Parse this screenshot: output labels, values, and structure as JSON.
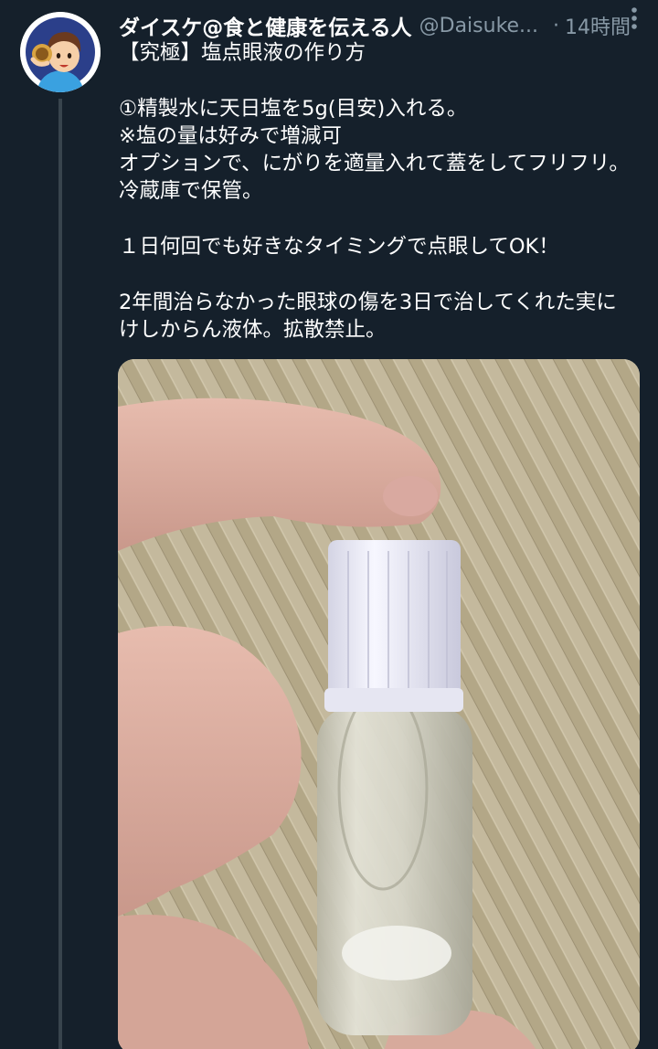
{
  "tweet": {
    "display_name": "ダイスケ@食と健康を伝える人",
    "handle": "@Daisuke...",
    "separator": "·",
    "timestamp": "14時間",
    "lines": [
      "【究極】塩点眼液の作り方",
      "",
      "①精製水に天日塩を5g(目安)入れる。",
      "※塩の量は好みで増減可",
      "オプションで、にがりを適量入れて蓋をしてフリフリ。",
      "冷蔵庫で保管。",
      "",
      "１日何回でも好きなタイミングで点眼してOK！",
      "",
      "2年間治らなかった眼球の傷を3日で治してくれた実に",
      "けしからん液体。拡散禁止。"
    ]
  },
  "icons": {
    "more": "more-vertical-icon",
    "avatar": "cartoon-avatar"
  },
  "colors": {
    "background": "#15202b",
    "secondary_text": "#8899a6",
    "thread_line": "#38444d"
  }
}
